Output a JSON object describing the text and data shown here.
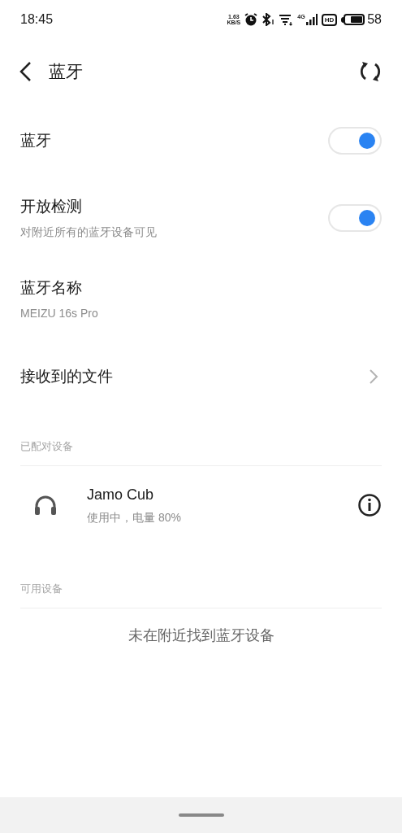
{
  "status_bar": {
    "time": "18:45",
    "speed_value": "1.63",
    "speed_unit": "KB/S",
    "network": "4G",
    "hd": "HD",
    "battery": "58"
  },
  "header": {
    "title": "蓝牙"
  },
  "settings": [
    {
      "kind": "toggle",
      "label": "蓝牙",
      "on": true
    },
    {
      "kind": "toggle",
      "label": "开放检测",
      "subtitle": "对附近所有的蓝牙设备可见",
      "on": true
    },
    {
      "kind": "info",
      "label": "蓝牙名称",
      "subtitle": "MEIZU 16s Pro"
    },
    {
      "kind": "link",
      "label": "接收到的文件"
    }
  ],
  "paired": {
    "header": "已配对设备",
    "devices": [
      {
        "name": "Jamo Cub",
        "status": "使用中，电量 80%"
      }
    ]
  },
  "available": {
    "header": "可用设备",
    "empty_message": "未在附近找到蓝牙设备"
  }
}
